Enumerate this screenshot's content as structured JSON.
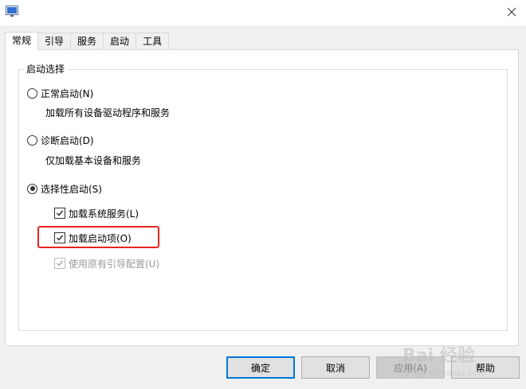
{
  "tabs": [
    {
      "label": "常规",
      "active": true
    },
    {
      "label": "引导",
      "active": false
    },
    {
      "label": "服务",
      "active": false
    },
    {
      "label": "启动",
      "active": false
    },
    {
      "label": "工具",
      "active": false
    }
  ],
  "startup_group": {
    "title": "启动选择",
    "normal": {
      "label": "正常启动(N)",
      "description": "加载所有设备驱动程序和服务",
      "checked": false
    },
    "diagnostic": {
      "label": "诊断启动(D)",
      "description": "仅加载基本设备和服务",
      "checked": false
    },
    "selective": {
      "label": "选择性启动(S)",
      "checked": true,
      "load_system_services": {
        "label": "加载系统服务(L)",
        "checked": true,
        "enabled": true
      },
      "load_startup_items": {
        "label": "加载启动项(O)",
        "checked": true,
        "enabled": true
      },
      "use_original_boot": {
        "label": "使用原有引导配置(U)",
        "checked": true,
        "enabled": false
      }
    }
  },
  "buttons": {
    "ok": "确定",
    "cancel": "取消",
    "apply": "应用(A)",
    "help": "帮助"
  },
  "watermark": {
    "text": "Bai 经验",
    "url_text": "jingyan.baidu.com"
  },
  "colors": {
    "highlight": "#e8241f",
    "default_button_border": "#0078d7"
  }
}
